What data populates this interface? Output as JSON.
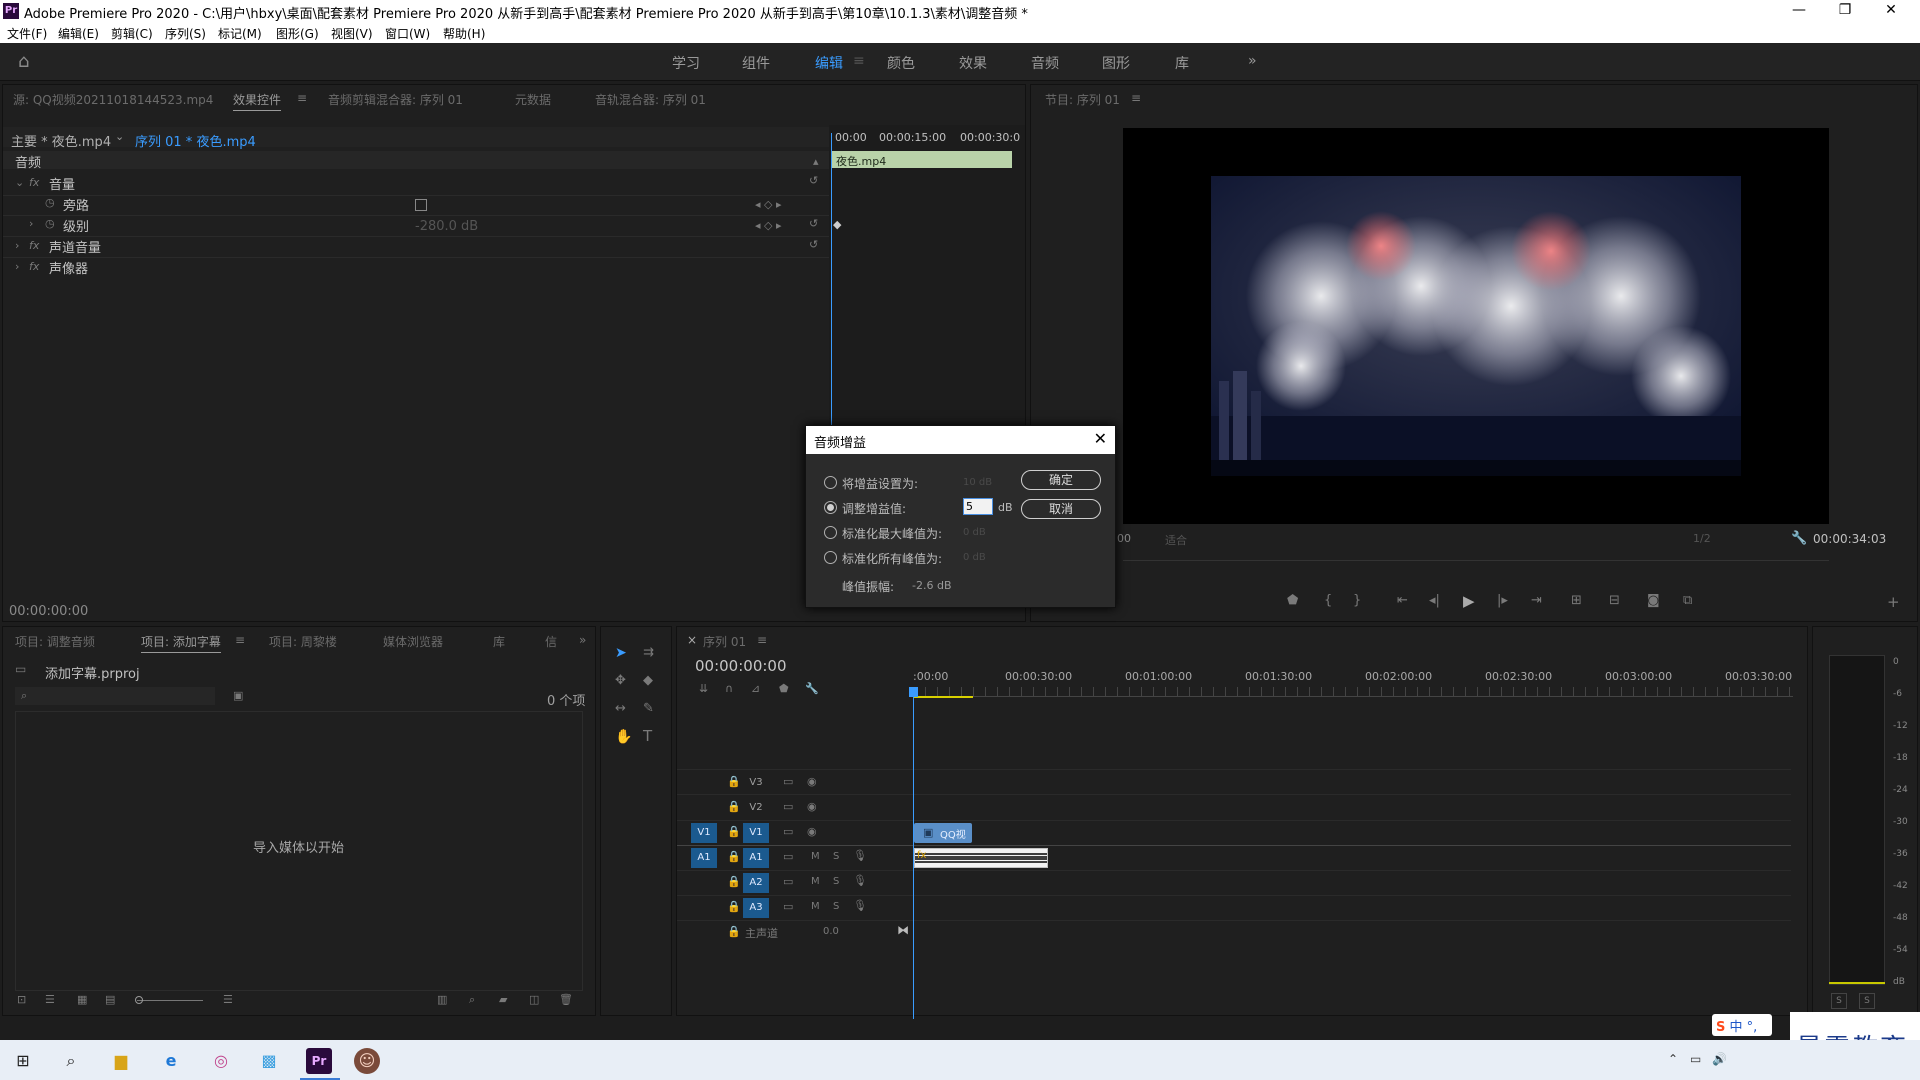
{
  "window": {
    "logo": "Pr",
    "title": "Adobe Premiere Pro 2020 - C:\\用户\\hbxy\\桌面\\配套素材 Premiere Pro 2020 从新手到高手\\配套素材 Premiere Pro 2020 从新手到高手\\第10章\\10.1.3\\素材\\调整音频 *",
    "minimize": "—",
    "maximize": "❐",
    "close": "✕"
  },
  "menu": [
    "文件(F)",
    "编辑(E)",
    "剪辑(C)",
    "序列(S)",
    "标记(M)",
    "图形(G)",
    "视图(V)",
    "窗口(W)",
    "帮助(H)"
  ],
  "workspaces": {
    "tabs": [
      "学习",
      "组件",
      "编辑",
      "颜色",
      "效果",
      "音频",
      "图形",
      "库"
    ],
    "active": "编辑",
    "more": "»"
  },
  "source_panel": {
    "tabs": [
      "源: QQ视频20211018144523.mp4",
      "效果控件",
      "音频剪辑混合器: 序列 01",
      "元数据",
      "音轨混合器: 序列 01"
    ],
    "master_clip": "主要 * 夜色.mp4",
    "sequence_clip": "序列 01 * 夜色.mp4",
    "section": "音频",
    "effects": [
      "音量",
      "旁路",
      "级别",
      "声道音量",
      "声像器"
    ],
    "level_value": "-280.0 dB",
    "timecodes": [
      "00:00",
      "00:00:15:00",
      "00:00:30:0"
    ],
    "clip_name": "夜色.mp4",
    "current_time": "00:00:00:00"
  },
  "program_panel": {
    "title": "节目: 序列 01",
    "timecode_left": "00",
    "fit": "适合",
    "quality": "1/2",
    "duration": "00:00:34:03"
  },
  "dialog": {
    "title": "音频增益",
    "close": "✕",
    "options": [
      {
        "label": "将增益设置为:",
        "value": "10 dB",
        "selected": false
      },
      {
        "label": "调整增益值:",
        "value": "5",
        "unit": "dB",
        "selected": true
      },
      {
        "label": "标准化最大峰值为:",
        "value": "0 dB",
        "selected": false
      },
      {
        "label": "标准化所有峰值为:",
        "value": "0 dB",
        "selected": false
      }
    ],
    "peak_label": "峰值振幅:",
    "peak_value": "-2.6 dB",
    "ok": "确定",
    "cancel": "取消"
  },
  "project_panel": {
    "tabs": [
      "项目: 调整音频",
      "项目: 添加字幕",
      "项目: 周黎楼",
      "媒体浏览器",
      "库",
      "信"
    ],
    "project_file": "添加字幕.prproj",
    "item_count": "0 个项",
    "empty_message": "导入媒体以开始"
  },
  "timeline": {
    "title": "序列 01",
    "timecode": "00:00:00:00",
    "ruler": [
      ":00:00",
      "00:00:30:00",
      "00:01:00:00",
      "00:01:30:00",
      "00:02:00:00",
      "00:02:30:00",
      "00:03:00:00",
      "00:03:30:00"
    ],
    "video_tracks": [
      "V3",
      "V2",
      "V1"
    ],
    "audio_tracks": [
      "A1",
      "A2",
      "A3"
    ],
    "master": "主声道",
    "master_value": "0.0",
    "src_v": "V1",
    "src_a": "A1",
    "video_clip": "QQ视",
    "mute": "M",
    "solo": "S"
  },
  "meter": {
    "ticks": [
      "0",
      "-6",
      "-12",
      "-18",
      "-24",
      "-30",
      "-36",
      "-42",
      "-48",
      "-54",
      "dB"
    ],
    "solo_buttons": [
      "S",
      "S"
    ]
  },
  "ime": {
    "label": "中",
    "extra": "°,"
  },
  "watermark": "最需教育",
  "colors": {
    "accent": "#3a9cff",
    "audio_clip": "#8fbf8f",
    "video_clip": "#5a8fc8"
  }
}
